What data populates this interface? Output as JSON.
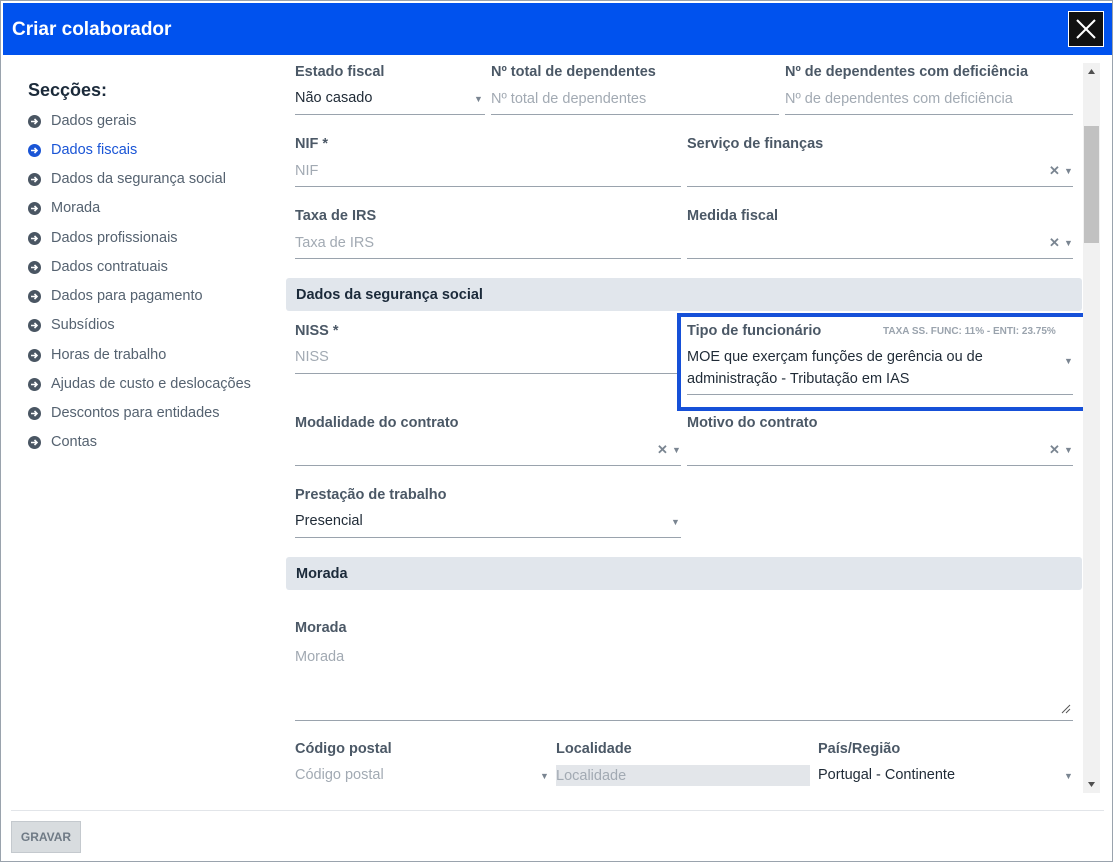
{
  "dialog": {
    "title": "Criar colaborador",
    "save_label": "GRAVAR"
  },
  "sidebar": {
    "title": "Secções:",
    "items": [
      {
        "label": "Dados gerais"
      },
      {
        "label": "Dados fiscais",
        "active": true
      },
      {
        "label": "Dados da segurança social"
      },
      {
        "label": "Morada"
      },
      {
        "label": "Dados profissionais"
      },
      {
        "label": "Dados contratuais"
      },
      {
        "label": "Dados para pagamento"
      },
      {
        "label": "Subsídios"
      },
      {
        "label": "Horas de trabalho"
      },
      {
        "label": "Ajudas de custo e deslocações"
      },
      {
        "label": "Descontos para entidades"
      },
      {
        "label": "Contas"
      }
    ]
  },
  "fiscal": {
    "estado_fiscal": {
      "label": "Estado fiscal",
      "value": "Não casado"
    },
    "total_dependentes": {
      "label": "Nº total de dependentes",
      "placeholder": "Nº total de dependentes"
    },
    "dependentes_deficiencia": {
      "label": "Nº de dependentes com deficiência",
      "placeholder": "Nº de dependentes com deficiência"
    },
    "nif": {
      "label": "NIF *",
      "placeholder": "NIF"
    },
    "servico_financas": {
      "label": "Serviço de finanças"
    },
    "taxa_irs": {
      "label": "Taxa de IRS",
      "placeholder": "Taxa de IRS"
    },
    "medida_fiscal": {
      "label": "Medida fiscal"
    }
  },
  "seguranca_social": {
    "section_title": "Dados da segurança social",
    "niss": {
      "label": "NISS *",
      "placeholder": "NISS"
    },
    "tipo_funcionario": {
      "label": "Tipo de funcionário",
      "rate_note": "TAXA SS. FUNC: 11% - ENTI: 23.75%",
      "value_line1": "MOE que exerçam funções de gerência ou de",
      "value_line2": "administração - Tributação em IAS"
    },
    "modalidade_contrato": {
      "label": "Modalidade do contrato"
    },
    "motivo_contrato": {
      "label": "Motivo do contrato"
    },
    "prestacao_trabalho": {
      "label": "Prestação de trabalho",
      "value": "Presencial"
    }
  },
  "morada": {
    "section_title": "Morada",
    "morada": {
      "label": "Morada",
      "placeholder": "Morada"
    },
    "codigo_postal": {
      "label": "Código postal",
      "placeholder": "Código postal"
    },
    "localidade": {
      "label": "Localidade",
      "placeholder": "Localidade"
    },
    "pais": {
      "label": "País/Região",
      "value": "Portugal - Continente"
    }
  },
  "icons": {
    "close": "close-icon",
    "section_arrow": "arrow-circle-right-icon",
    "caret": "caret-down-icon",
    "clear": "clear-x-icon",
    "resize": "resize-grip-icon"
  },
  "colors": {
    "header": "#0052ee",
    "active_section": "#1a55d6",
    "highlight_border": "#1650d8",
    "section_bar": "#e1e6ec"
  }
}
